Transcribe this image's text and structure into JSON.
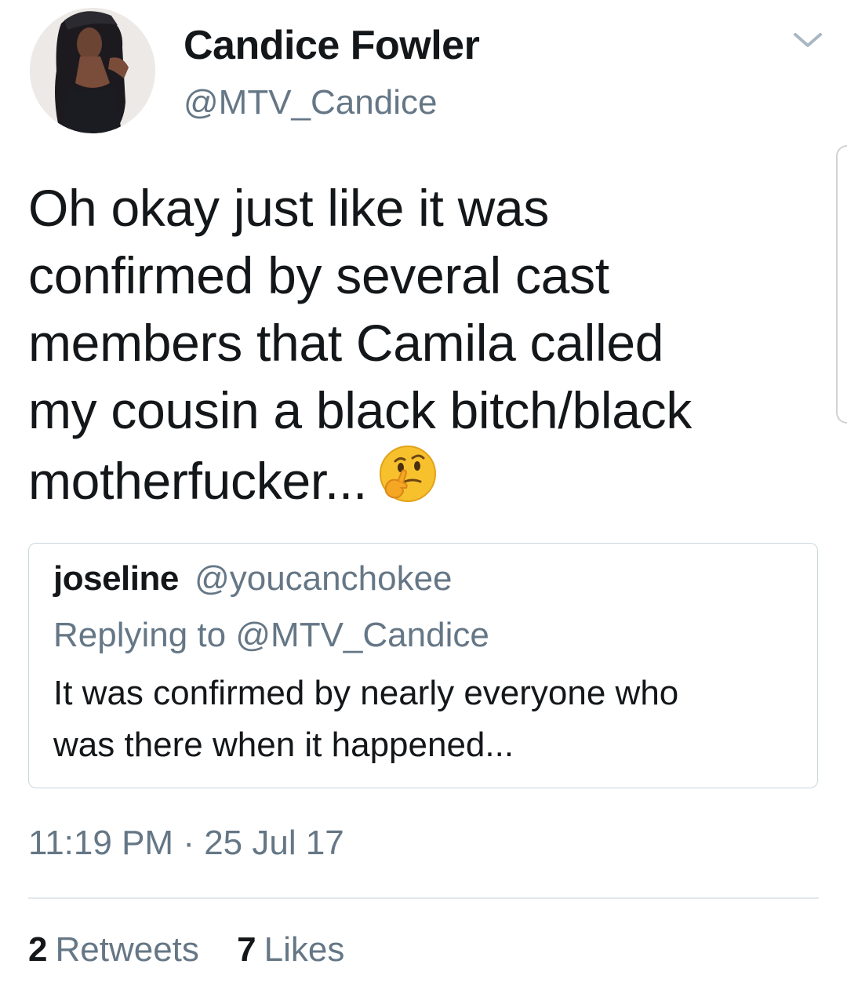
{
  "author": {
    "display_name": "Candice Fowler",
    "handle": "@MTV_Candice"
  },
  "tweet": {
    "text_lines": [
      "Oh okay just like it was",
      "confirmed by several cast",
      "members that Camila called",
      "my cousin a black bitch/black",
      "motherfucker..."
    ],
    "emoji": "thinking-face-emoji"
  },
  "quoted_tweet": {
    "display_name": "joseline",
    "handle": "@youcanchokee",
    "replying_prefix": "Replying to",
    "replying_to": "@MTV_Candice",
    "text_lines": [
      "It was confirmed by nearly everyone who",
      "was there when it happened..."
    ]
  },
  "meta": {
    "time": "11:19 PM",
    "separator": "·",
    "date": "25 Jul 17"
  },
  "stats": {
    "retweets_count": "2",
    "retweets_label": "Retweets",
    "likes_count": "7",
    "likes_label": "Likes"
  },
  "colors": {
    "text_primary": "#14171a",
    "text_secondary": "#657786",
    "border": "#ccd6dd",
    "divider": "#e1e8ed"
  },
  "icons": {
    "menu": "chevron-down-icon"
  }
}
